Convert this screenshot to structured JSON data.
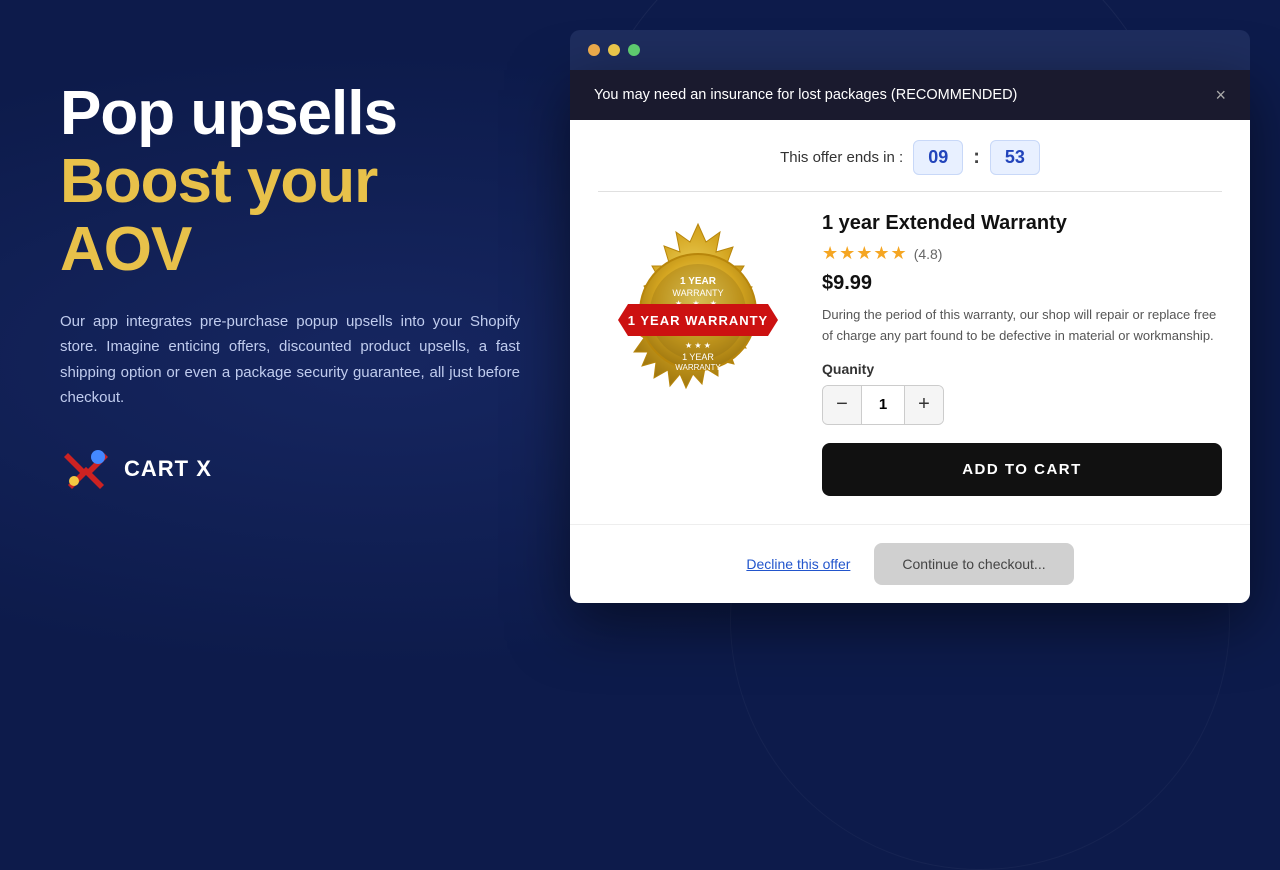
{
  "background": {
    "color": "#0d1b4b"
  },
  "left": {
    "headline_white": "Pop upsells",
    "headline_gold_line1": "Boost your",
    "headline_gold_line2": "AOV",
    "description": "Our app integrates pre-purchase popup upsells into your Shopify store. Imagine enticing offers, discounted product upsells, a fast shipping option or even a package security guarantee, all just before checkout.",
    "brand_name": "CART X"
  },
  "browser": {
    "dots": [
      "orange",
      "yellow",
      "green"
    ]
  },
  "popup": {
    "header_text": "You may need an insurance for lost packages (RECOMMENDED)",
    "close_label": "×",
    "timer_label": "This offer ends in :",
    "timer_minutes": "09",
    "timer_seconds": "53",
    "product": {
      "title": "1 year Extended Warranty",
      "stars": "★★★★★",
      "rating": "(4.8)",
      "price": "$9.99",
      "description": "During the period of this warranty, our shop will repair or replace free of charge any part found to be defective in material or workmanship.",
      "quantity_label": "Quanity",
      "quantity_value": "1",
      "qty_minus": "−",
      "qty_plus": "+"
    },
    "add_to_cart_label": "ADD TO CART",
    "decline_label": "Decline this offer",
    "continue_label": "Continue to checkout..."
  }
}
